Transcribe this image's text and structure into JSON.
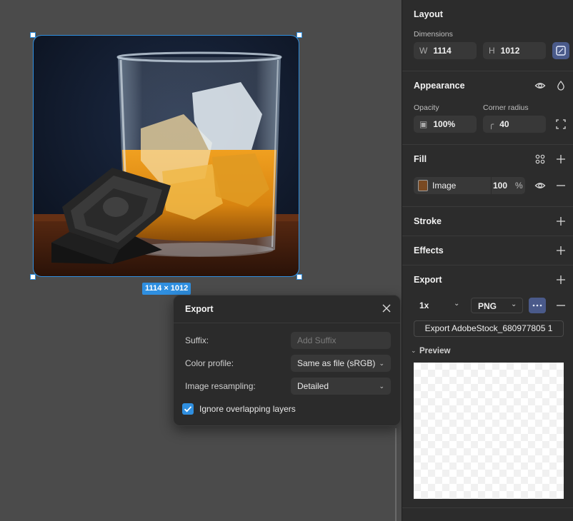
{
  "canvas": {
    "size_badge": "1114 × 1012"
  },
  "export_dialog": {
    "title": "Export",
    "suffix_label": "Suffix:",
    "suffix_placeholder": "Add Suffix",
    "color_profile_label": "Color profile:",
    "color_profile_value": "Same as file (sRGB)",
    "resampling_label": "Image resampling:",
    "resampling_value": "Detailed",
    "ignore_overlap_label": "Ignore overlapping layers",
    "ignore_overlap_checked": true
  },
  "panel": {
    "layout": {
      "title": "Layout",
      "dimensions_label": "Dimensions",
      "w_prefix": "W",
      "w_value": "1114",
      "h_prefix": "H",
      "h_value": "1012"
    },
    "appearance": {
      "title": "Appearance",
      "opacity_label": "Opacity",
      "opacity_value": "100%",
      "radius_label": "Corner radius",
      "radius_value": "40"
    },
    "fill": {
      "title": "Fill",
      "type_label": "Image",
      "opacity_value": "100",
      "unit": "%"
    },
    "stroke": {
      "title": "Stroke"
    },
    "effects": {
      "title": "Effects"
    },
    "export": {
      "title": "Export",
      "scale_value": "1x",
      "format_value": "PNG",
      "export_button_label": "Export AdobeStock_680977805 1",
      "preview_label": "Preview"
    }
  },
  "colors": {
    "accent": "#2f8fe0",
    "panel_bg": "#2c2c2c",
    "canvas_bg": "#4b4b4b",
    "options_button": "#4a5a8a"
  }
}
